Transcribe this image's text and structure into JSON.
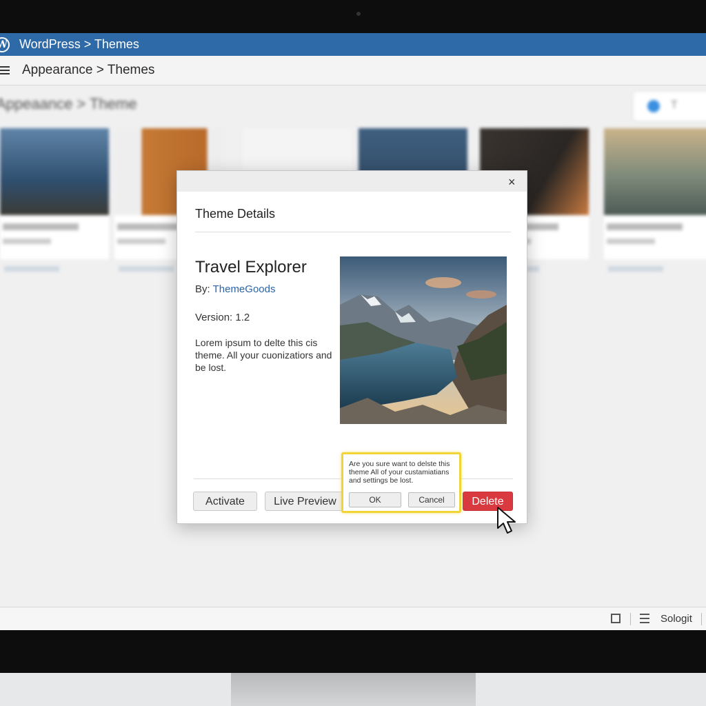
{
  "wp_bar": {
    "title": "WordPress > Themes",
    "logo": "wordpress-logo"
  },
  "sub_bar": {
    "breadcrumb": "Appearance > Themes"
  },
  "background_page": {
    "title": "Appeaance > Theme"
  },
  "bottom_bar": {
    "label": "Sologit"
  },
  "modal": {
    "close_label": "×",
    "heading": "Theme Details",
    "theme_name": "Travel Explorer",
    "author_prefix": "By:",
    "author": "ThemeGoods",
    "version": "Version: 1.2",
    "description": "Lorem ipsum to delte this cis theme. All your cuonizatiors and be lost.",
    "buttons": {
      "activate": "Activate",
      "live_preview": "Live Preview",
      "delete": "Delete"
    },
    "colors": {
      "delete": "#d83a3f",
      "confirm_border": "#f1d437",
      "link": "#2a63a8",
      "wp_bar": "#2d6aa7"
    }
  },
  "confirm": {
    "message": "Are you sure want to delste this theme All of your custamiatians and settings be lost.",
    "ok": "OK",
    "cancel": "Cancel"
  }
}
